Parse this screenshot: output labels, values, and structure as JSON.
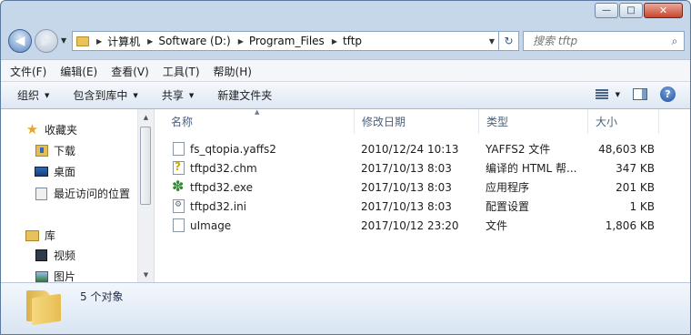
{
  "window": {
    "caption": {
      "minimize": "—",
      "maximize": "□",
      "close": "✕"
    }
  },
  "address_bar": {
    "breadcrumbs": [
      "计算机",
      "Software (D:)",
      "Program_Files",
      "tftp"
    ],
    "search_placeholder": "搜索 tftp"
  },
  "menu": [
    "文件(F)",
    "编辑(E)",
    "查看(V)",
    "工具(T)",
    "帮助(H)"
  ],
  "toolbar": {
    "organize": "组织",
    "include_in_library": "包含到库中",
    "share": "共享",
    "new_folder": "新建文件夹"
  },
  "nav_pane": {
    "favorites": "收藏夹",
    "downloads": "下载",
    "desktop": "桌面",
    "recent": "最近访问的位置",
    "libraries": "库",
    "videos": "视频",
    "pictures": "图片"
  },
  "columns": {
    "name": "名称",
    "modified": "修改日期",
    "type": "类型",
    "size": "大小"
  },
  "files": [
    {
      "name": "fs_qtopia.yaffs2",
      "modified": "2010/12/24 10:13",
      "type": "YAFFS2 文件",
      "size": "48,603 KB",
      "icon": "generic-file-icon"
    },
    {
      "name": "tftpd32.chm",
      "modified": "2017/10/13 8:03",
      "type": "编译的 HTML 帮...",
      "size": "347 KB",
      "icon": "chm-help-icon"
    },
    {
      "name": "tftpd32.exe",
      "modified": "2017/10/13 8:03",
      "type": "应用程序",
      "size": "201 KB",
      "icon": "exe-app-icon"
    },
    {
      "name": "tftpd32.ini",
      "modified": "2017/10/13 8:03",
      "type": "配置设置",
      "size": "1 KB",
      "icon": "ini-settings-icon"
    },
    {
      "name": "uImage",
      "modified": "2017/10/12 23:20",
      "type": "文件",
      "size": "1,806 KB",
      "icon": "generic-file-icon"
    }
  ],
  "details": {
    "item_count": "5 个对象"
  }
}
